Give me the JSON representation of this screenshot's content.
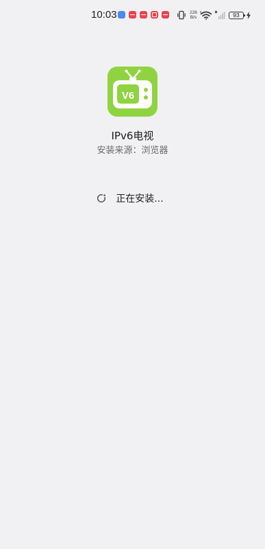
{
  "status_bar": {
    "time": "10:03",
    "net_speed_value": "226",
    "net_speed_unit": "B/s",
    "battery_level": "93",
    "notification_icons": [
      "app-notification-icon",
      "video-app-icon",
      "video-app-icon",
      "box-app-icon",
      "video-app-icon"
    ]
  },
  "app": {
    "name": "IPv6电视",
    "icon_text": "V6",
    "icon_color": "#8fd440",
    "source": "安装来源：浏览器"
  },
  "install": {
    "status": "正在安装..."
  }
}
